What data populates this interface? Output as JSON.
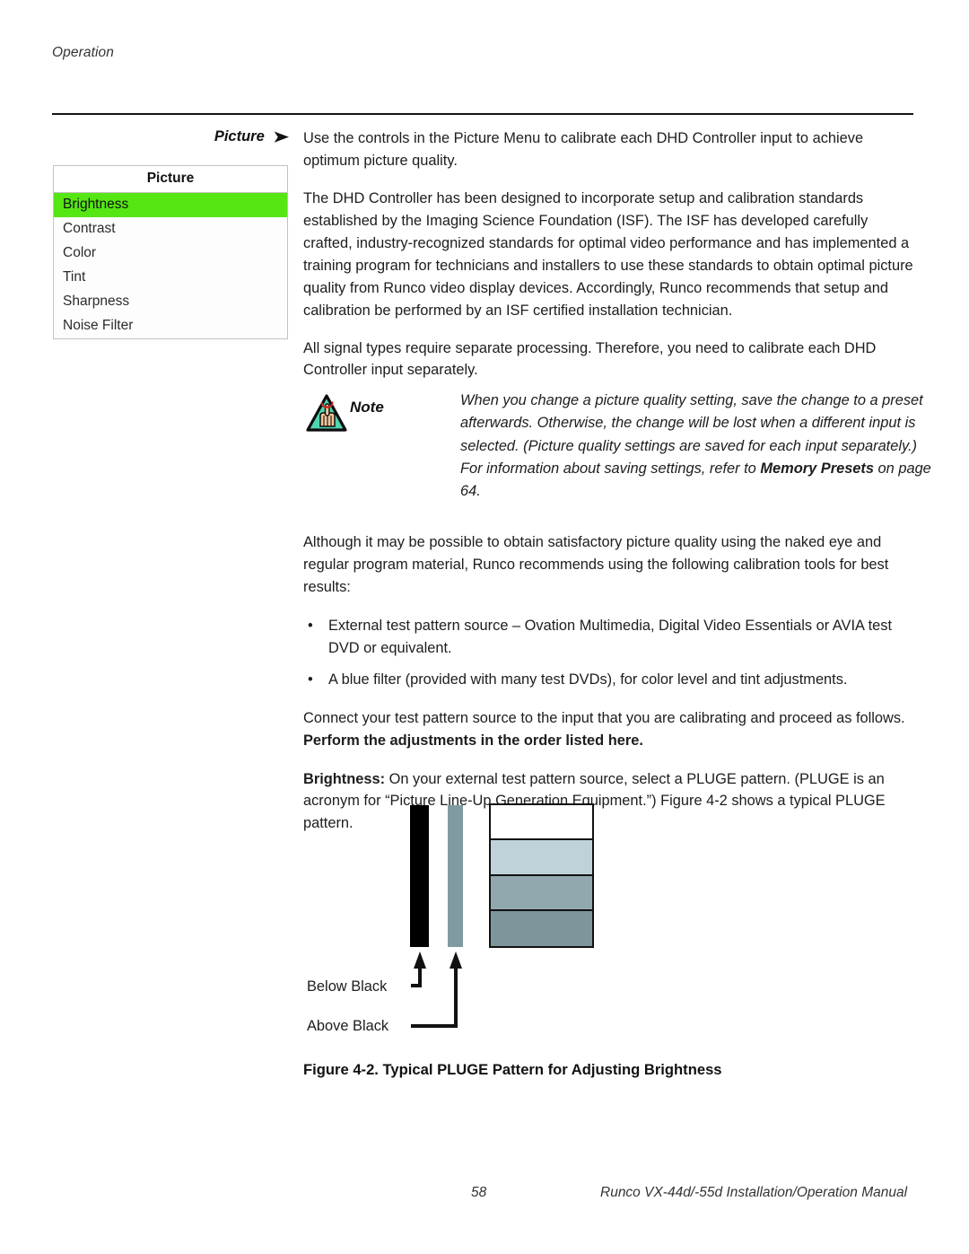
{
  "header": {
    "running_head": "Operation"
  },
  "section": {
    "label": "Picture",
    "arrow_icon": "arrow-right-icon",
    "arrow_glyph": "➤"
  },
  "osd_menu": {
    "title": "Picture",
    "items": [
      {
        "label": "Brightness",
        "selected": true
      },
      {
        "label": "Contrast",
        "selected": false
      },
      {
        "label": "Color",
        "selected": false
      },
      {
        "label": "Tint",
        "selected": false
      },
      {
        "label": "Sharpness",
        "selected": false
      },
      {
        "label": "Noise Filter",
        "selected": false
      }
    ],
    "highlight_color": "#55e614",
    "border_color": "#c2c2c2"
  },
  "body": {
    "p1": "Use the controls in the Picture Menu to calibrate each DHD Controller input to achieve optimum picture quality.",
    "p2": "The DHD Controller has been designed to incorporate setup and calibration standards established by the Imaging Science Foundation (ISF). The ISF has developed carefully crafted, industry-recognized standards for optimal video performance and has implemented a training program for technicians and installers to use these standards to obtain optimal picture quality from Runco video display devices. Accordingly, Runco recommends that setup and calibration be performed by an ISF certified installation technician.",
    "p3": "All signal types require separate processing. Therefore, you need to calibrate each DHD Controller input separately."
  },
  "note": {
    "icon_name": "note-hand-reminder-icon",
    "word": "Note",
    "text_part1": "When you change a picture quality setting, save the change to a preset afterwards. Otherwise, the change will be lost when a different input is selected. (Picture quality settings are saved for each input separately.) For information about saving settings, refer to ",
    "text_bold": "Memory Presets",
    "text_part2": " on page 64.",
    "icon_triangle_fill": "#4fd6b0",
    "icon_hand_fill": "#f2c79a",
    "icon_string_color": "#cc2222"
  },
  "body2": {
    "p1": "Although it may be possible to obtain satisfactory picture quality using the naked eye and regular program material, Runco recommends using the following calibration tools for best results:",
    "bullet_glyph": "•",
    "bullets": [
      "External test pattern source – Ovation Multimedia, Digital Video Essentials or AVIA test DVD or equivalent.",
      "A blue filter (provided with many test DVDs), for color level and tint adjustments."
    ],
    "p2_normal": "Connect your test pattern source to the input that you are calibrating and proceed as follows. ",
    "p2_bold": "Perform the adjustments in the order listed here.",
    "p3_bold": "Brightness:",
    "p3_normal": " On your external test pattern source, select a PLUGE pattern. (PLUGE is an acronym for “Picture Line-Up Generation Equipment.”) Figure 4-2 shows a typical PLUGE pattern."
  },
  "figure": {
    "caption": "Figure 4-2. Typical PLUGE Pattern for Adjusting Brightness",
    "label_below_black": "Below Black",
    "label_above_black": "Above Black",
    "bar_below_black_color": "#000000",
    "bar_above_black_color": "#7f9ba1",
    "step_colors": [
      "#ffffff",
      "#bfd2d9",
      "#91a9ae",
      "#7d969b"
    ],
    "outline_color": "#111111"
  },
  "footer": {
    "page_number": "58",
    "manual_title": "Runco VX-44d/-55d Installation/Operation Manual"
  }
}
